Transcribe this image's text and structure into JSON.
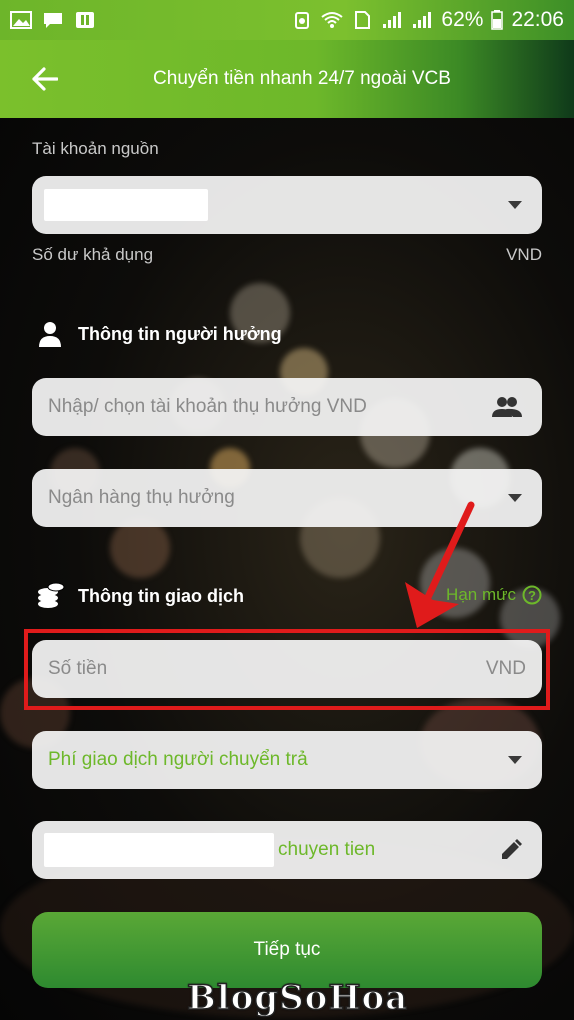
{
  "status_bar": {
    "battery": "62%",
    "time": "22:06"
  },
  "app_bar": {
    "title": "Chuyển tiền nhanh 24/7 ngoài VCB"
  },
  "source_account": {
    "label": "Tài khoản nguồn",
    "balance_label": "Số dư khả dụng",
    "currency": "VND"
  },
  "beneficiary": {
    "section_title": "Thông tin người hưởng",
    "account_placeholder": "Nhập/ chọn tài khoản thụ hưởng VND",
    "bank_placeholder": "Ngân hàng thụ hưởng"
  },
  "transaction": {
    "section_title": "Thông tin giao dịch",
    "limit_link": "Hạn mức",
    "amount_placeholder": "Số tiền",
    "amount_currency": "VND",
    "fee_option": "Phí giao dịch người chuyển trả",
    "note_suffix": "chuyen tien"
  },
  "continue_button": "Tiếp tục",
  "watermark": "BlogSoHoa",
  "colors": {
    "brand_green": "#6db82a",
    "highlight_red": "#e01b1b"
  }
}
